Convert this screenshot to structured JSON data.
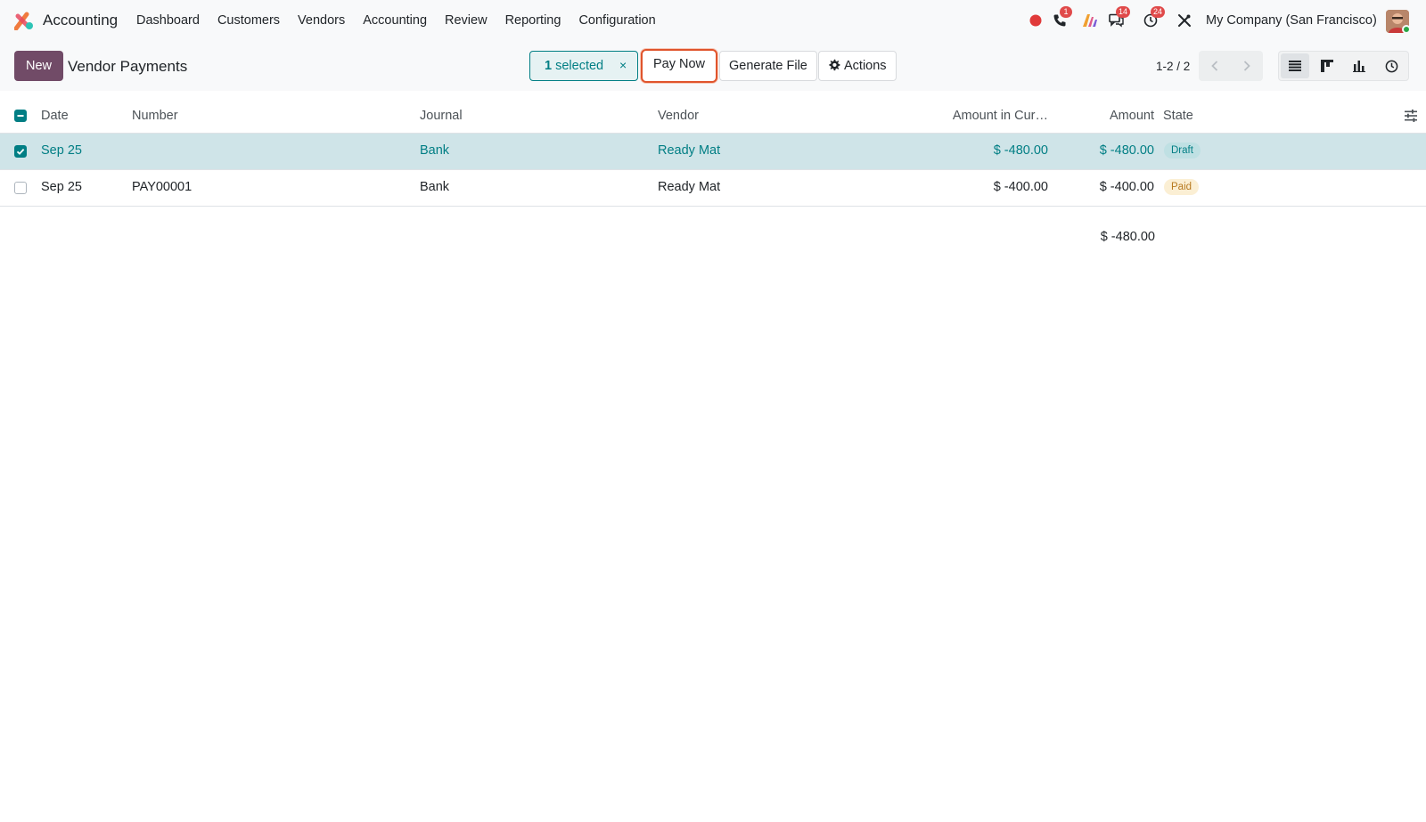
{
  "navbar": {
    "app_name": "Accounting",
    "menu": [
      "Dashboard",
      "Customers",
      "Vendors",
      "Accounting",
      "Review",
      "Reporting",
      "Configuration"
    ],
    "badges": {
      "phone": "1",
      "messages": "14",
      "activities": "24"
    },
    "company": "My Company (San Francisco)"
  },
  "control": {
    "new_label": "New",
    "title": "Vendor Payments",
    "selected_count": "1",
    "selected_text": "selected",
    "close_glyph": "×",
    "pay_now_label": "Pay Now",
    "generate_file_label": "Generate File",
    "actions_label": "Actions",
    "pager": "1-2 / 2"
  },
  "table": {
    "headers": {
      "date": "Date",
      "number": "Number",
      "journal": "Journal",
      "vendor": "Vendor",
      "amount_currency": "Amount in Cur…",
      "amount": "Amount",
      "state": "State"
    },
    "rows": [
      {
        "date": "Sep 25",
        "number": "",
        "journal": "Bank",
        "vendor": "Ready Mat",
        "amount_currency": "$ -480.00",
        "amount": "$ -480.00",
        "state": "Draft"
      },
      {
        "date": "Sep 25",
        "number": "PAY00001",
        "journal": "Bank",
        "vendor": "Ready Mat",
        "amount_currency": "$ -400.00",
        "amount": "$ -400.00",
        "state": "Paid"
      }
    ],
    "total": "$ -480.00"
  },
  "colors": {
    "brand": "#714b67",
    "accent": "#017e84",
    "highlight": "#e0542c"
  }
}
